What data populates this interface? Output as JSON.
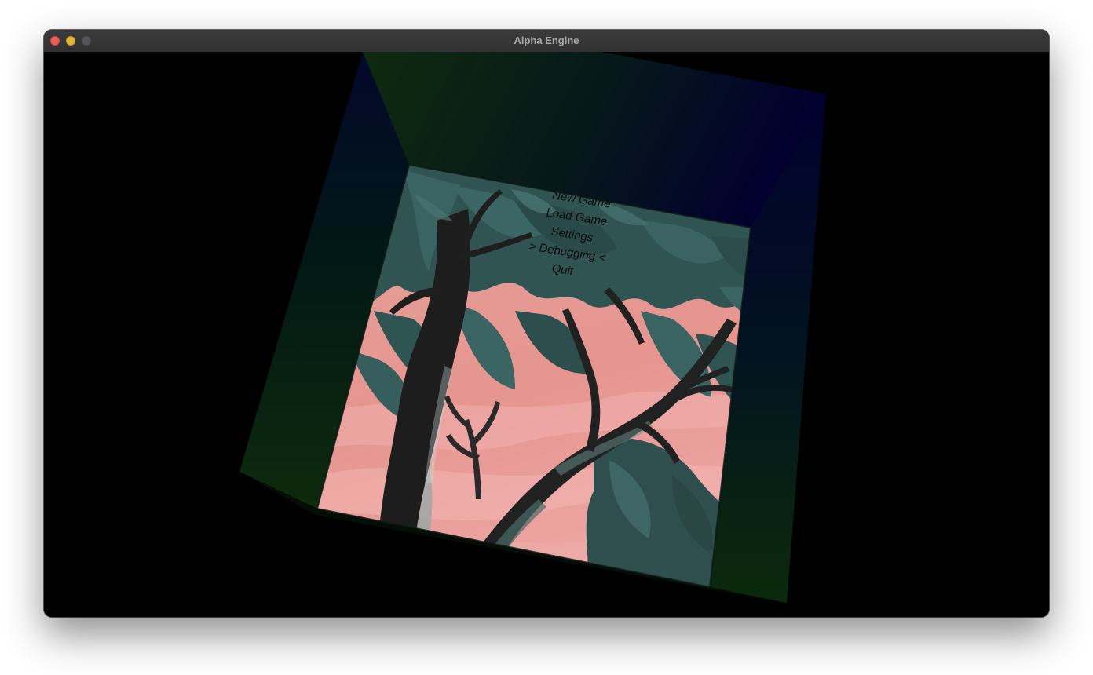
{
  "window": {
    "title": "Alpha Engine"
  },
  "menu": {
    "items": [
      {
        "label": "New Game"
      },
      {
        "label": "Load Game"
      },
      {
        "label": "Settings"
      },
      {
        "label": "> Debugging <",
        "selected": true
      },
      {
        "label": "Quit"
      }
    ]
  },
  "colors": {
    "titlebar": "#363535",
    "background": "#000000",
    "room_wall_green": "#0f2a0e",
    "room_wall_blue": "#01002b",
    "sky_pink": "#e8a09a",
    "foliage": "#2f4f4f",
    "trunk": "#1e1e1e"
  }
}
